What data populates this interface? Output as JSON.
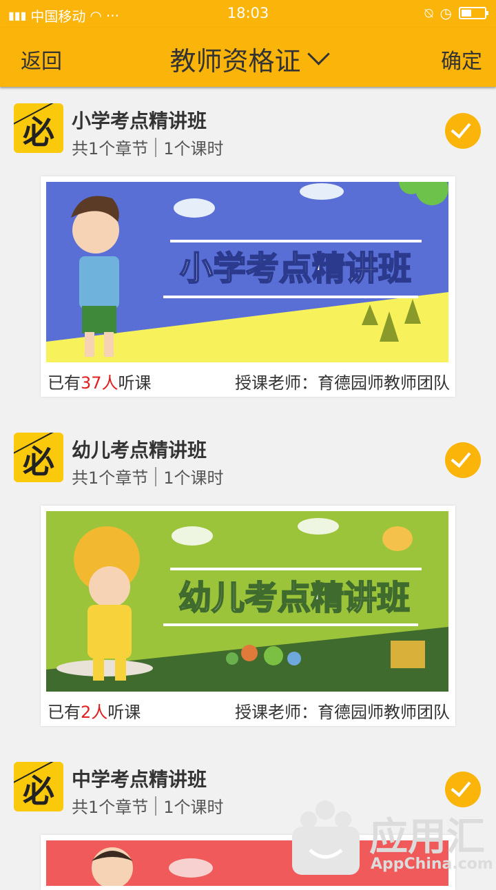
{
  "status_bar": {
    "carrier": "中国移动",
    "dots": "···",
    "time": "18:03"
  },
  "nav": {
    "back_label": "返回",
    "title": "教师资格证",
    "confirm_label": "确定"
  },
  "courses": [
    {
      "badge": "必",
      "name": "小学考点精讲班",
      "chapters": "共1个章节",
      "hours": "1个课时",
      "banner_title": "小学考点精讲班",
      "listeners_prefix": "已有",
      "listeners_count": "37人",
      "listeners_suffix": "听课",
      "teacher": "授课老师：育德园师教师团队",
      "selected": true
    },
    {
      "badge": "必",
      "name": "幼儿考点精讲班",
      "chapters": "共1个章节",
      "hours": "1个课时",
      "banner_title": "幼儿考点精讲班",
      "listeners_prefix": "已有",
      "listeners_count": "2人",
      "listeners_suffix": "听课",
      "teacher": "授课老师：育德园师教师团队",
      "selected": true
    },
    {
      "badge": "必",
      "name": "中学考点精讲班",
      "chapters": "共1个章节",
      "hours": "1个课时",
      "selected": true
    }
  ],
  "watermark": {
    "name": "应用汇",
    "domain": "AppChina.com"
  },
  "colors": {
    "accent": "#fbb40a",
    "badge": "#fbc90c",
    "highlight_number": "#e02020",
    "banner1_sky": "#5a6fd6",
    "banner1_ground": "#f7f25c",
    "banner2_sky": "#9cc43a",
    "banner2_ground": "#3f6b2e",
    "banner3_sky": "#f05a5a"
  }
}
